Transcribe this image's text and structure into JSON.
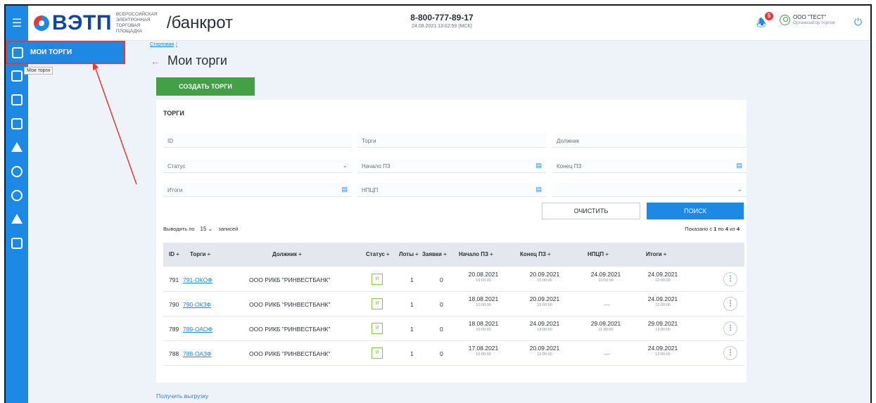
{
  "header": {
    "logo_text": "ВЭТП",
    "logo_sub": "ВСЕРОССИЙСКАЯ ЭЛЕКТРОННАЯ ТОРГОВАЯ ПЛОЩАДКА",
    "logo_section": "/банкрот",
    "phone": "8-800-777-89-17",
    "datetime": "24.08.2021 13:02:59 (МСК)",
    "notifications_count": "5",
    "user_name": "ООО \"ТЕСТ\"",
    "user_role": "Организатор торгов",
    "colors": {
      "brand": "#1e88e5",
      "accent_red": "#e53935",
      "success": "#43a047"
    }
  },
  "sidebar": {
    "active_label": "МОИ ТОРГИ",
    "tooltip": "Мои торги",
    "icons": [
      "menu-icon",
      "my-trades-icon",
      "document-icon",
      "building-icon",
      "list-icon",
      "scales-icon",
      "person-icon",
      "person-alt-icon",
      "house-icon",
      "calculator-icon"
    ]
  },
  "page": {
    "breadcrumb": "Стартовая",
    "breadcrumb_sep": "/",
    "title": "Мои торги",
    "create_button": "СОЗДАТЬ ТОРГИ",
    "export_link": "Получить выгрузку"
  },
  "filters": {
    "card_title": "ТОРГИ",
    "id_placeholder": "ID",
    "trades_placeholder": "Торги",
    "debtor_placeholder": "Должник",
    "status_placeholder": "Статус",
    "start_pz_placeholder": "Начало ПЗ",
    "end_pz_placeholder": "Конец ПЗ",
    "results_placeholder": "Итоги",
    "npcp_placeholder": "НПЦП",
    "extra_select": "",
    "clear_button": "ОЧИСТИТЬ",
    "search_button": "ПОИСК"
  },
  "table": {
    "per_page_label": "Выводить по",
    "per_page_value": "15",
    "per_page_suffix": "записей",
    "shown_prefix": "Показано с",
    "shown_from": "1",
    "shown_to_label": "по",
    "shown_to": "4",
    "shown_of_label": "из",
    "shown_total": "4",
    "columns": {
      "id": "ID ÷",
      "trades": "Торги ÷",
      "debtor": "Должник ÷",
      "status": "Статус ÷",
      "lots": "Лоты ÷",
      "bids": "Заявки ÷",
      "start_pz": "Начало ПЗ ÷",
      "end_pz": "Конец ПЗ ÷",
      "npcp": "НПЦП ÷",
      "results": "Итоги ÷"
    },
    "rows": [
      {
        "id": "791",
        "trade": "791-ОКОФ",
        "debtor": "ООО РИКБ \"РИНВЕСТБАНК\"",
        "status": "И",
        "lots": "1",
        "bids": "0",
        "start_date": "20.08.2021",
        "start_time": "10:00:00",
        "end_date": "20.09.2021",
        "end_time": "15:00:00",
        "npcp_date": "24.09.2021",
        "npcp_time": "10:00:00",
        "result_date": "24.09.2021",
        "result_time": "12:00:00"
      },
      {
        "id": "790",
        "trade": "790-ОКЗФ",
        "debtor": "ООО РИКБ \"РИНВЕСТБАНК\"",
        "status": "И",
        "lots": "1",
        "bids": "0",
        "start_date": "18.08.2021",
        "start_time": "10:00:00",
        "end_date": "20.09.2021",
        "end_time": "15:00:00",
        "npcp_dash": "—",
        "result_date": "24.09.2021",
        "result_time": "12:00:00"
      },
      {
        "id": "789",
        "trade": "789-ОАОФ",
        "debtor": "ООО РИКБ \"РИНВЕСТБАНК\"",
        "status": "И",
        "lots": "1",
        "bids": "0",
        "start_date": "18.08.2021",
        "start_time": "10:00:00",
        "end_date": "24.09.2021",
        "end_time": "18:00:00",
        "npcp_date": "29.09.2021",
        "npcp_time": "11:00:00",
        "result_date": "29.09.2021",
        "result_time": "13:00:00"
      },
      {
        "id": "788",
        "trade": "788-ОАЗФ",
        "debtor": "ООО РИКБ \"РИНВЕСТБАНК\"",
        "status": "И",
        "lots": "1",
        "bids": "0",
        "start_date": "17.08.2021",
        "start_time": "10:00:00",
        "end_date": "20.09.2021",
        "end_time": "15:00:00",
        "npcp_dash": "—",
        "result_date": "24.09.2021",
        "result_time": "12:00:00"
      }
    ]
  }
}
